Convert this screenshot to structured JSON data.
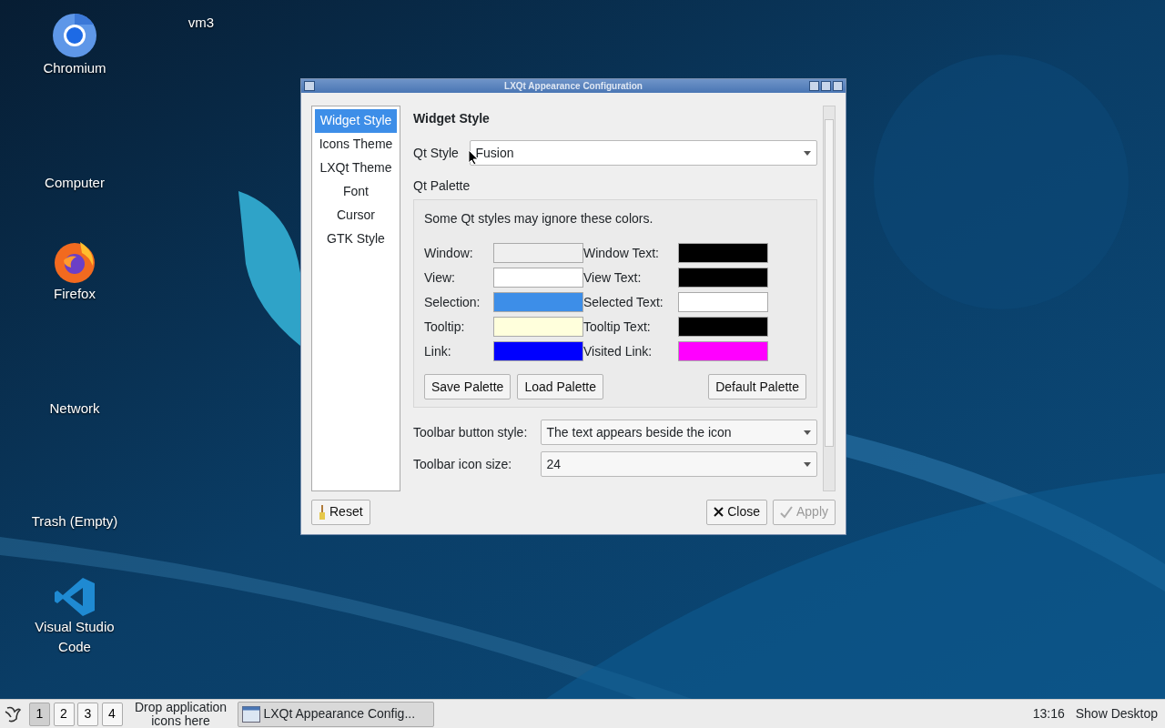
{
  "desktop_icons": [
    {
      "label": "Chromium",
      "kind": "chromium"
    },
    {
      "label": "vm3",
      "kind": "blank"
    },
    {
      "label": "Computer",
      "kind": "blank"
    },
    {
      "label": "Firefox",
      "kind": "firefox"
    },
    {
      "label": "Network",
      "kind": "blank"
    },
    {
      "label": "Trash (Empty)",
      "kind": "blank"
    },
    {
      "label": "Visual Studio Code",
      "kind": "vscode"
    }
  ],
  "window": {
    "title": "LXQt Appearance Configuration",
    "sidebar": {
      "items": [
        {
          "label": "Widget Style",
          "selected": true
        },
        {
          "label": "Icons Theme",
          "selected": false
        },
        {
          "label": "LXQt Theme",
          "selected": false
        },
        {
          "label": "Font",
          "selected": false
        },
        {
          "label": "Cursor",
          "selected": false
        },
        {
          "label": "GTK Style",
          "selected": false
        }
      ]
    },
    "heading": "Widget Style",
    "qt_style": {
      "label": "Qt Style",
      "value": "Fusion"
    },
    "palette": {
      "title": "Qt Palette",
      "note": "Some Qt styles may ignore these colors.",
      "rows": [
        {
          "label": "Window:",
          "color": "#efefef"
        },
        {
          "label": "Window Text:",
          "color": "#000000"
        },
        {
          "label": "View:",
          "color": "#ffffff"
        },
        {
          "label": "View Text:",
          "color": "#000000"
        },
        {
          "label": "Selection:",
          "color": "#3d8ee8"
        },
        {
          "label": "Selected Text:",
          "color": "#ffffff"
        },
        {
          "label": "Tooltip:",
          "color": "#ffffdc"
        },
        {
          "label": "Tooltip Text:",
          "color": "#000000"
        },
        {
          "label": "Link:",
          "color": "#0000ff"
        },
        {
          "label": "Visited Link:",
          "color": "#ff00ff"
        }
      ],
      "buttons": [
        "Save Palette",
        "Load Palette"
      ],
      "default_button": "Default Palette"
    },
    "toolbar_button_style": {
      "label": "Toolbar button style:",
      "value": "The text appears beside the icon"
    },
    "toolbar_icon_size": {
      "label": "Toolbar icon size:",
      "value": "24"
    },
    "footer": [
      {
        "label": "Reset",
        "kind": "reset",
        "disabled": false
      },
      {
        "label": "Close",
        "kind": "close",
        "disabled": false
      },
      {
        "label": "Apply",
        "kind": "apply",
        "disabled": true
      }
    ]
  },
  "taskbar": {
    "desktops": [
      {
        "label": "1",
        "selected": true
      },
      {
        "label": "2",
        "selected": false
      },
      {
        "label": "3",
        "selected": false
      },
      {
        "label": "4",
        "selected": false
      }
    ],
    "quicklaunch_hint": "Drop application icons here",
    "tasks": [
      "LXQt Appearance Config..."
    ],
    "clock": "13:16",
    "show_desktop": "Show Desktop"
  }
}
